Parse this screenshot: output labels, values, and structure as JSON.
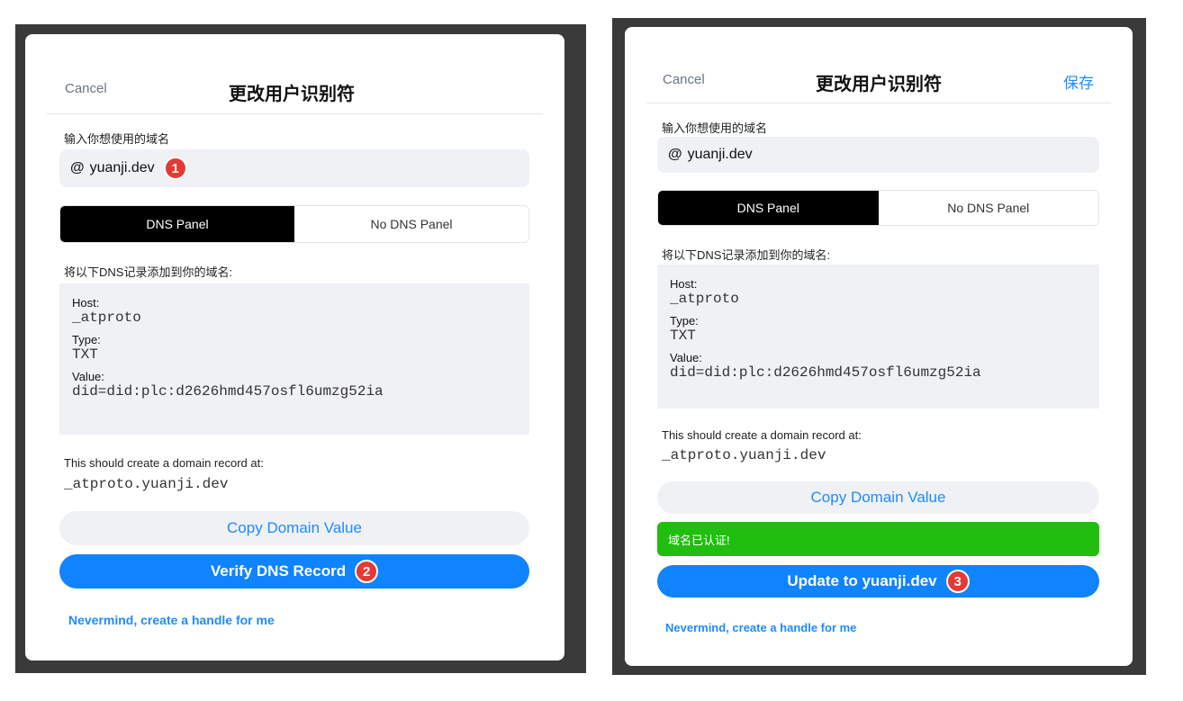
{
  "left": {
    "cancel": "Cancel",
    "title": "更改用户识别符",
    "domain_label": "输入你想使用的域名",
    "domain_value": "yuanji.dev",
    "at_symbol": "@",
    "badge_1": "1",
    "seg_dns": "DNS Panel",
    "seg_no_dns": "No DNS Panel",
    "instructions": "将以下DNS记录添加到你的域名:",
    "host_label": "Host:",
    "host_value": "_atproto",
    "type_label": "Type:",
    "type_value": "TXT",
    "value_label": "Value:",
    "value_value": "did=did:plc:d2626hmd457osfl6umzg52ia",
    "record_note": "This should create a domain record at:",
    "record_domain": "_atproto.yuanji.dev",
    "copy_button": "Copy Domain Value",
    "verify_button": "Verify DNS Record",
    "badge_2": "2",
    "nevermind": "Nevermind, create a handle for me"
  },
  "right": {
    "cancel": "Cancel",
    "title": "更改用户识别符",
    "save": "保存",
    "domain_label": "输入你想使用的域名",
    "domain_value": "yuanji.dev",
    "at_symbol": "@",
    "seg_dns": "DNS Panel",
    "seg_no_dns": "No DNS Panel",
    "instructions": "将以下DNS记录添加到你的域名:",
    "host_label": "Host:",
    "host_value": "_atproto",
    "type_label": "Type:",
    "type_value": "TXT",
    "value_label": "Value:",
    "value_value": "did=did:plc:d2626hmd457osfl6umzg52ia",
    "record_note": "This should create a domain record at:",
    "record_domain": "_atproto.yuanji.dev",
    "copy_button": "Copy Domain Value",
    "success": "域名已认证!",
    "update_button": "Update to yuanji.dev",
    "badge_3": "3",
    "nevermind": "Nevermind, create a handle for me"
  },
  "colors": {
    "accent": "#1083fe",
    "link": "#1e8bff",
    "success": "#20be0e",
    "badge": "#e53935",
    "backdrop": "#3a3a3a"
  }
}
